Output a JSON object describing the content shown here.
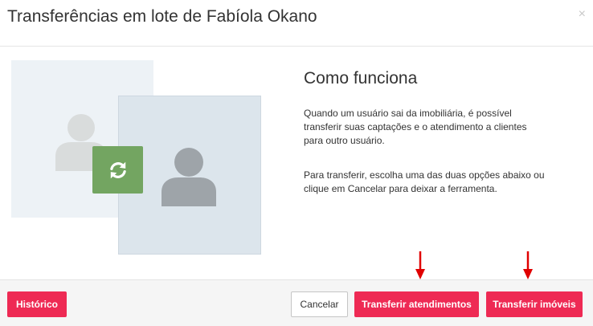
{
  "modal": {
    "title": "Transferências em lote de Fabíola Okano",
    "close_label": "×"
  },
  "illustration": {
    "sync_icon": "sync-icon",
    "person_icon": "user-icon",
    "sync_color": "#73a561"
  },
  "content": {
    "heading": "Como funciona",
    "paragraph1": "Quando um usuário sai da imobiliária, é possível transferir suas captações e o atendimento a clientes para outro usuário.",
    "paragraph2": "Para transferir, escolha uma das duas opções abaixo ou clique em Cancelar para deixar a ferramenta."
  },
  "footer": {
    "history_label": "Histórico",
    "cancel_label": "Cancelar",
    "transfer_services_label": "Transferir atendimentos",
    "transfer_properties_label": "Transferir imóveis"
  },
  "colors": {
    "primary": "#ee2a54",
    "annotation_arrow": "#e00000"
  }
}
